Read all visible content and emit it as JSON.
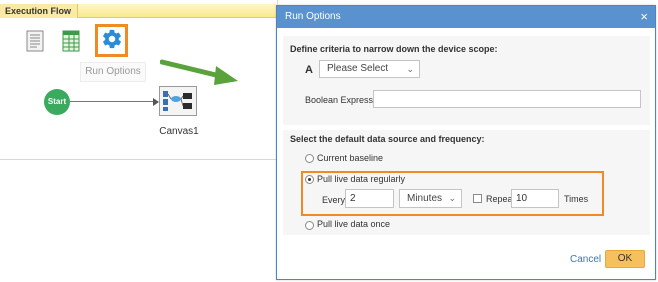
{
  "flow": {
    "tab_label": "Execution Flow",
    "tooltip": "Run Options",
    "start_label": "Start",
    "canvas_label": "Canvas1"
  },
  "dialog": {
    "title": "Run Options",
    "close_glyph": "×",
    "section1_title": "Define criteria to narrow down the device scope:",
    "criteria_letter": "A",
    "criteria_select": "Please Select",
    "boolean_label": "Boolean Expression:",
    "boolean_value": "",
    "section2_title": "Select the default data source and frequency:",
    "option_current": "Current baseline",
    "option_live_regular": "Pull live data regularly",
    "option_live_once": "Pull live data once",
    "selected_option": "Pull live data regularly",
    "every_label": "Every:",
    "every_value": "2",
    "unit_select": "Minutes",
    "repeat_label": "Repeat:",
    "repeat_checked": false,
    "repeat_value": "10",
    "times_label": "Times",
    "cancel_label": "Cancel",
    "ok_label": "OK"
  },
  "colors": {
    "highlight": "#f08a24",
    "dialog_header": "#5a92cf",
    "start_node": "#3aaa5e",
    "ok_button": "#f6c15d",
    "arrow": "#5aa23c"
  },
  "icons": [
    "document-icon",
    "spreadsheet-icon",
    "gear-icon",
    "close-icon",
    "chevron-down-icon"
  ]
}
